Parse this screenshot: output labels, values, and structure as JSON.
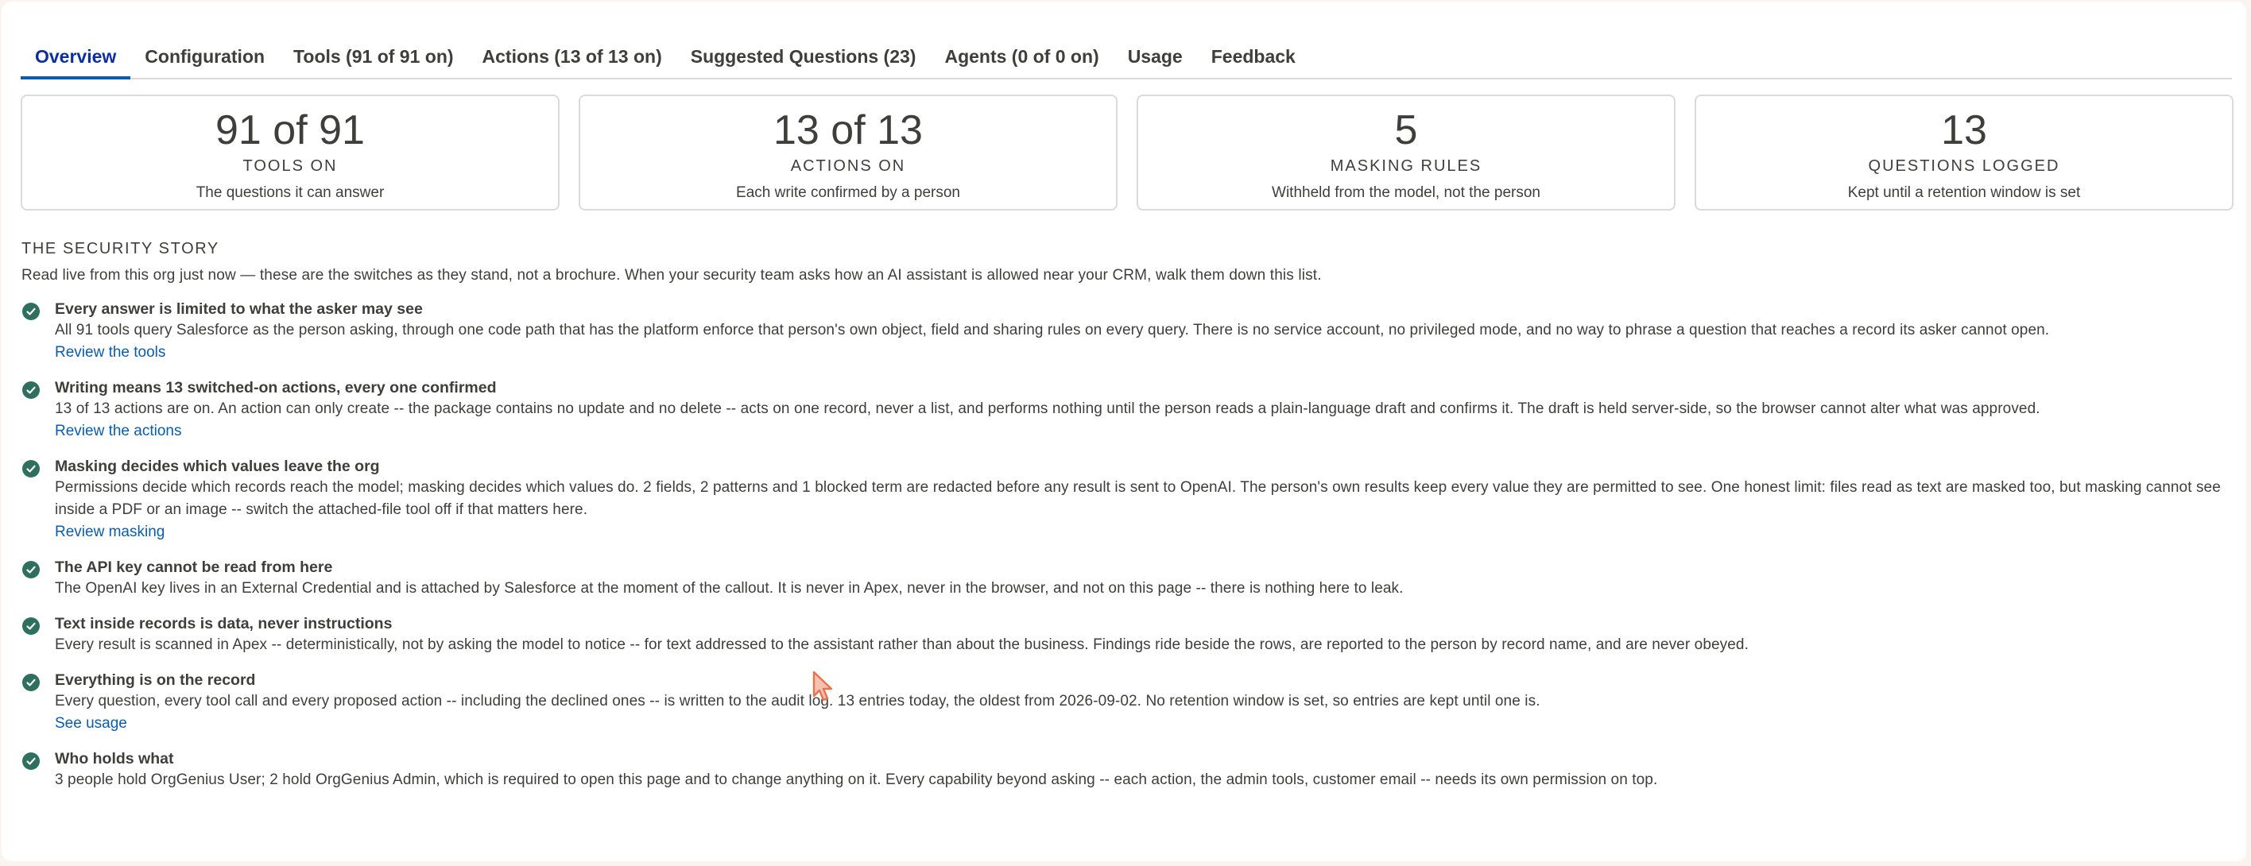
{
  "tabs": [
    {
      "label": "Overview",
      "active": true
    },
    {
      "label": "Configuration",
      "active": false
    },
    {
      "label": "Tools (91 of 91 on)",
      "active": false
    },
    {
      "label": "Actions (13 of 13 on)",
      "active": false
    },
    {
      "label": "Suggested Questions (23)",
      "active": false
    },
    {
      "label": "Agents (0 of 0 on)",
      "active": false
    },
    {
      "label": "Usage",
      "active": false
    },
    {
      "label": "Feedback",
      "active": false
    }
  ],
  "stats": [
    {
      "value": "91 of 91",
      "label": "TOOLS ON",
      "desc": "The questions it can answer"
    },
    {
      "value": "13 of 13",
      "label": "ACTIONS ON",
      "desc": "Each write confirmed by a person"
    },
    {
      "value": "5",
      "label": "MASKING RULES",
      "desc": "Withheld from the model, not the person"
    },
    {
      "value": "13",
      "label": "QUESTIONS LOGGED",
      "desc": "Kept until a retention window is set"
    }
  ],
  "story": {
    "heading": "THE SECURITY STORY",
    "intro": "Read live from this org just now — these are the switches as they stand, not a brochure. When your security team asks how an AI assistant is allowed near your CRM, walk them down this list.",
    "items": [
      {
        "title": "Every answer is limited to what the asker may see",
        "body": "All 91 tools query Salesforce as the person asking, through one code path that has the platform enforce that person's own object, field and sharing rules on every query. There is no service account, no privileged mode, and no way to phrase a question that reaches a record its asker cannot open.",
        "link": "Review the tools"
      },
      {
        "title": "Writing means 13 switched-on actions, every one confirmed",
        "body": "13 of 13 actions are on. An action can only create -- the package contains no update and no delete -- acts on one record, never a list, and performs nothing until the person reads a plain-language draft and confirms it. The draft is held server-side, so the browser cannot alter what was approved.",
        "link": "Review the actions"
      },
      {
        "title": "Masking decides which values leave the org",
        "body": "Permissions decide which records reach the model; masking decides which values do. 2 fields, 2 patterns and 1 blocked term are redacted before any result is sent to OpenAI. The person's own results keep every value they are permitted to see. One honest limit: files read as text are masked too, but masking cannot see inside a PDF or an image -- switch the attached-file tool off if that matters here.",
        "link": "Review masking"
      },
      {
        "title": "The API key cannot be read from here",
        "body": "The OpenAI key lives in an External Credential and is attached by Salesforce at the moment of the callout. It is never in Apex, never in the browser, and not on this page -- there is nothing here to leak.",
        "link": ""
      },
      {
        "title": "Text inside records is data, never instructions",
        "body": "Every result is scanned in Apex -- deterministically, not by asking the model to notice -- for text addressed to the assistant rather than about the business. Findings ride beside the rows, are reported to the person by record name, and are never obeyed.",
        "link": ""
      },
      {
        "title": "Everything is on the record",
        "body": "Every question, every tool call and every proposed action -- including the declined ones -- is written to the audit log. 13 entries today, the oldest from 2026-09-02. No retention window is set, so entries are kept until one is.",
        "link": "See usage"
      },
      {
        "title": "Who holds what",
        "body": "3 people hold OrgGenius User; 2 hold OrgGenius Admin, which is required to open this page and to change anything on it. Every capability beyond asking -- each action, the admin tools, customer email -- needs its own permission on top.",
        "link": ""
      }
    ]
  },
  "colors": {
    "accent": "#0b5cab",
    "active_tab_text": "#0b2f9f",
    "check": "#2e6f5e",
    "cursor": "#e8734f"
  },
  "icons": {
    "check": "check-circle-icon",
    "cursor": "mouse-cursor-icon"
  }
}
